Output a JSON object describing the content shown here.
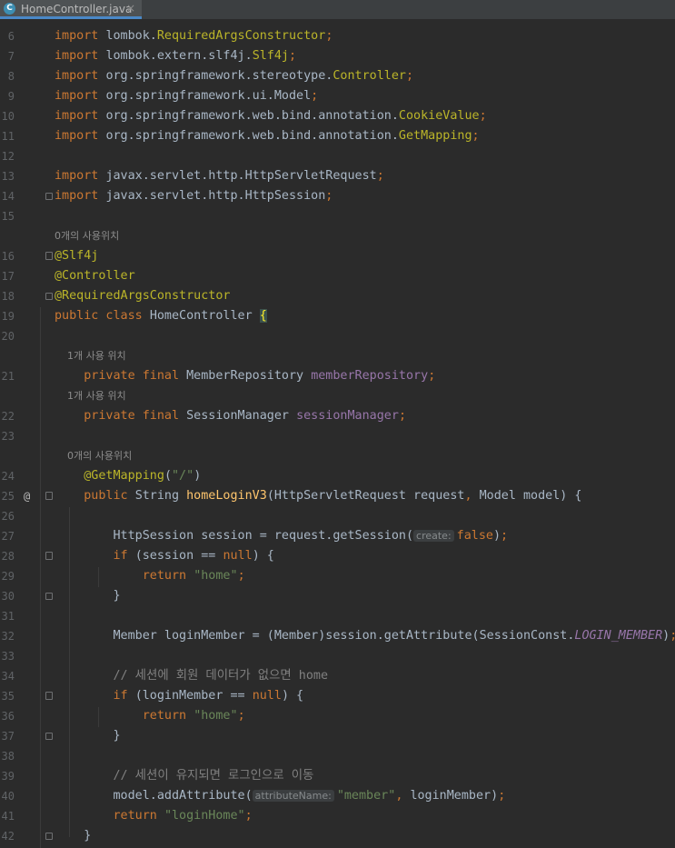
{
  "tab": {
    "filename": "HomeController.java",
    "file_icon_letter": "C",
    "close_glyph": "×"
  },
  "colors": {
    "background": "#2b2b2b",
    "keyword": "#cc7832",
    "annotation": "#bbb529",
    "string": "#6a8759",
    "field": "#9876aa",
    "comment": "#808080",
    "method": "#ffc66d"
  },
  "lines": [
    {
      "n": "6",
      "kind": "code",
      "segs": [
        [
          "k",
          "import "
        ],
        [
          "t",
          "lombok."
        ],
        [
          "a",
          "RequiredArgsConstructor"
        ],
        [
          "k",
          ";"
        ]
      ]
    },
    {
      "n": "7",
      "kind": "code",
      "segs": [
        [
          "k",
          "import "
        ],
        [
          "t",
          "lombok.extern.slf4j."
        ],
        [
          "a",
          "Slf4j"
        ],
        [
          "k",
          ";"
        ]
      ]
    },
    {
      "n": "8",
      "kind": "code",
      "segs": [
        [
          "k",
          "import "
        ],
        [
          "t",
          "org.springframework.stereotype."
        ],
        [
          "a",
          "Controller"
        ],
        [
          "k",
          ";"
        ]
      ]
    },
    {
      "n": "9",
      "kind": "code",
      "segs": [
        [
          "k",
          "import "
        ],
        [
          "t",
          "org.springframework.ui.Model"
        ],
        [
          "k",
          ";"
        ]
      ]
    },
    {
      "n": "10",
      "kind": "code",
      "segs": [
        [
          "k",
          "import "
        ],
        [
          "t",
          "org.springframework.web.bind.annotation."
        ],
        [
          "a",
          "CookieValue"
        ],
        [
          "k",
          ";"
        ]
      ]
    },
    {
      "n": "11",
      "kind": "code",
      "segs": [
        [
          "k",
          "import "
        ],
        [
          "t",
          "org.springframework.web.bind.annotation."
        ],
        [
          "a",
          "GetMapping"
        ],
        [
          "k",
          ";"
        ]
      ]
    },
    {
      "n": "12",
      "kind": "code",
      "segs": []
    },
    {
      "n": "13",
      "kind": "code",
      "segs": [
        [
          "k",
          "import "
        ],
        [
          "t",
          "javax.servlet.http.HttpServletRequest"
        ],
        [
          "k",
          ";"
        ]
      ]
    },
    {
      "n": "14",
      "kind": "code",
      "fold": "close",
      "segs": [
        [
          "k",
          "import "
        ],
        [
          "t",
          "javax.servlet.http.HttpSession"
        ],
        [
          "k",
          ";"
        ]
      ]
    },
    {
      "n": "15",
      "kind": "code",
      "segs": []
    },
    {
      "n": "",
      "kind": "hint",
      "text": "0개의 사용위치"
    },
    {
      "n": "16",
      "kind": "code",
      "fold": "open",
      "segs": [
        [
          "a",
          "@Slf4j"
        ]
      ]
    },
    {
      "n": "17",
      "kind": "code",
      "segs": [
        [
          "a",
          "@Controller"
        ]
      ]
    },
    {
      "n": "18",
      "kind": "code",
      "fold": "close",
      "segs": [
        [
          "a",
          "@RequiredArgsConstructor"
        ]
      ]
    },
    {
      "n": "19",
      "kind": "code",
      "segs": [
        [
          "k",
          "public class "
        ],
        [
          "t",
          "HomeController "
        ],
        [
          "br",
          "{"
        ]
      ]
    },
    {
      "n": "20",
      "kind": "code",
      "segs": []
    },
    {
      "n": "",
      "kind": "hint",
      "text": "    1개 사용 위치"
    },
    {
      "n": "21",
      "kind": "code",
      "segs": [
        [
          "t",
          "    "
        ],
        [
          "k",
          "private final "
        ],
        [
          "t",
          "MemberRepository "
        ],
        [
          "f",
          "memberRepository"
        ],
        [
          "k",
          ";"
        ]
      ]
    },
    {
      "n": "",
      "kind": "hint",
      "text": "    1개 사용 위치"
    },
    {
      "n": "22",
      "kind": "code",
      "segs": [
        [
          "t",
          "    "
        ],
        [
          "k",
          "private final "
        ],
        [
          "t",
          "SessionManager "
        ],
        [
          "f",
          "sessionManager"
        ],
        [
          "k",
          ";"
        ]
      ]
    },
    {
      "n": "23",
      "kind": "code",
      "segs": []
    },
    {
      "n": "",
      "kind": "hint",
      "text": "    0개의 사용위치"
    },
    {
      "n": "24",
      "kind": "code",
      "segs": [
        [
          "t",
          "    "
        ],
        [
          "a",
          "@GetMapping"
        ],
        [
          "t",
          "("
        ],
        [
          "s",
          "\"/\""
        ],
        [
          "t",
          ")"
        ]
      ]
    },
    {
      "n": "25",
      "kind": "code",
      "fold": "open",
      "at": "@",
      "segs": [
        [
          "t",
          "    "
        ],
        [
          "k",
          "public "
        ],
        [
          "t",
          "String "
        ],
        [
          "m",
          "homeLoginV3"
        ],
        [
          "t",
          "(HttpServletRequest request"
        ],
        [
          "k",
          ", "
        ],
        [
          "t",
          "Model model) {"
        ]
      ]
    },
    {
      "n": "26",
      "kind": "code",
      "segs": []
    },
    {
      "n": "27",
      "kind": "code",
      "segs": [
        [
          "t",
          "        HttpSession session = request.getSession("
        ],
        [
          "inlay",
          "create:"
        ],
        [
          "k",
          "false"
        ],
        [
          "t",
          ")"
        ],
        [
          "k",
          ";"
        ]
      ]
    },
    {
      "n": "28",
      "kind": "code",
      "fold": "open",
      "segs": [
        [
          "t",
          "        "
        ],
        [
          "k",
          "if "
        ],
        [
          "t",
          "(session == "
        ],
        [
          "k",
          "null"
        ],
        [
          "t",
          ") {"
        ]
      ]
    },
    {
      "n": "29",
      "kind": "code",
      "segs": [
        [
          "t",
          "            "
        ],
        [
          "k",
          "return "
        ],
        [
          "s",
          "\"home\""
        ],
        [
          "k",
          ";"
        ]
      ]
    },
    {
      "n": "30",
      "kind": "code",
      "fold": "close",
      "segs": [
        [
          "t",
          "        }"
        ]
      ]
    },
    {
      "n": "31",
      "kind": "code",
      "segs": []
    },
    {
      "n": "32",
      "kind": "code",
      "segs": [
        [
          "t",
          "        Member loginMember = (Member)session.getAttribute(SessionConst."
        ],
        [
          "fi",
          "LOGIN_MEMBER"
        ],
        [
          "t",
          ")"
        ],
        [
          "k",
          ";"
        ]
      ]
    },
    {
      "n": "33",
      "kind": "code",
      "segs": []
    },
    {
      "n": "34",
      "kind": "code",
      "segs": [
        [
          "t",
          "        "
        ],
        [
          "c",
          "// 세션에 회원 데이터가 없으면 home"
        ]
      ]
    },
    {
      "n": "35",
      "kind": "code",
      "fold": "open",
      "segs": [
        [
          "t",
          "        "
        ],
        [
          "k",
          "if "
        ],
        [
          "t",
          "(loginMember == "
        ],
        [
          "k",
          "null"
        ],
        [
          "t",
          ") {"
        ]
      ]
    },
    {
      "n": "36",
      "kind": "code",
      "segs": [
        [
          "t",
          "            "
        ],
        [
          "k",
          "return "
        ],
        [
          "s",
          "\"home\""
        ],
        [
          "k",
          ";"
        ]
      ]
    },
    {
      "n": "37",
      "kind": "code",
      "fold": "close",
      "segs": [
        [
          "t",
          "        }"
        ]
      ]
    },
    {
      "n": "38",
      "kind": "code",
      "segs": []
    },
    {
      "n": "39",
      "kind": "code",
      "segs": [
        [
          "t",
          "        "
        ],
        [
          "c",
          "// 세션이 유지되면 로그인으로 이동"
        ]
      ]
    },
    {
      "n": "40",
      "kind": "code",
      "segs": [
        [
          "t",
          "        model.addAttribute("
        ],
        [
          "inlay",
          "attributeName:"
        ],
        [
          "s",
          "\"member\""
        ],
        [
          "k",
          ", "
        ],
        [
          "t",
          "loginMember)"
        ],
        [
          "k",
          ";"
        ]
      ]
    },
    {
      "n": "41",
      "kind": "code",
      "segs": [
        [
          "t",
          "        "
        ],
        [
          "k",
          "return "
        ],
        [
          "s",
          "\"loginHome\""
        ],
        [
          "k",
          ";"
        ]
      ]
    },
    {
      "n": "42",
      "kind": "code",
      "fold": "close",
      "segs": [
        [
          "t",
          "    }"
        ]
      ]
    }
  ]
}
